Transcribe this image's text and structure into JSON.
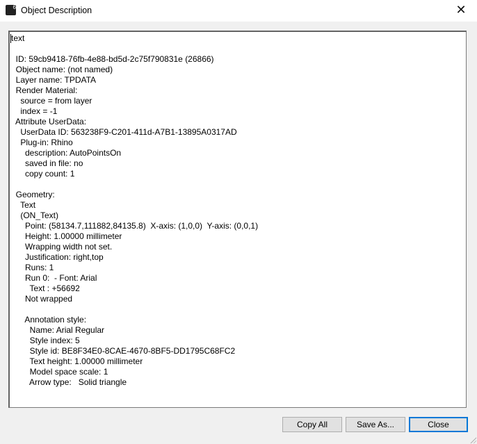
{
  "window": {
    "title": "Object Description",
    "app_icon": "rhino-6-icon",
    "close_glyph": "✕"
  },
  "content": {
    "lines": [
      "text",
      "",
      "  ID: 59cb9418-76fb-4e88-bd5d-2c75f790831e (26866)",
      "  Object name: (not named)",
      "  Layer name: TPDATA",
      "  Render Material:",
      "    source = from layer",
      "    index = -1",
      "  Attribute UserData:",
      "    UserData ID: 563238F9-C201-411d-A7B1-13895A0317AD",
      "    Plug-in: Rhino",
      "      description: AutoPointsOn",
      "      saved in file: no",
      "      copy count: 1",
      "",
      "  Geometry:",
      "    Text",
      "    (ON_Text)",
      "      Point: (58134.7,111882,84135.8)  X-axis: (1,0,0)  Y-axis: (0,0,1)",
      "      Height: 1.00000 millimeter",
      "      Wrapping width not set.",
      "      Justification: right,top",
      "      Runs: 1",
      "      Run 0:  - Font: Arial",
      "        Text : +56692",
      "      Not wrapped",
      "",
      "      Annotation style:",
      "        Name: Arial Regular",
      "        Style index: 5",
      "        Style id: BE8F34E0-8CAE-4670-8BF5-DD1795C68FC2",
      "        Text height: 1.00000 millimeter",
      "        Model space scale: 1",
      "        Arrow type:   Solid triangle"
    ]
  },
  "buttons": {
    "copy_all": "Copy All",
    "save_as": "Save As...",
    "close": "Close"
  },
  "colors": {
    "accent": "#0078d7",
    "background": "#f0f0f0"
  }
}
